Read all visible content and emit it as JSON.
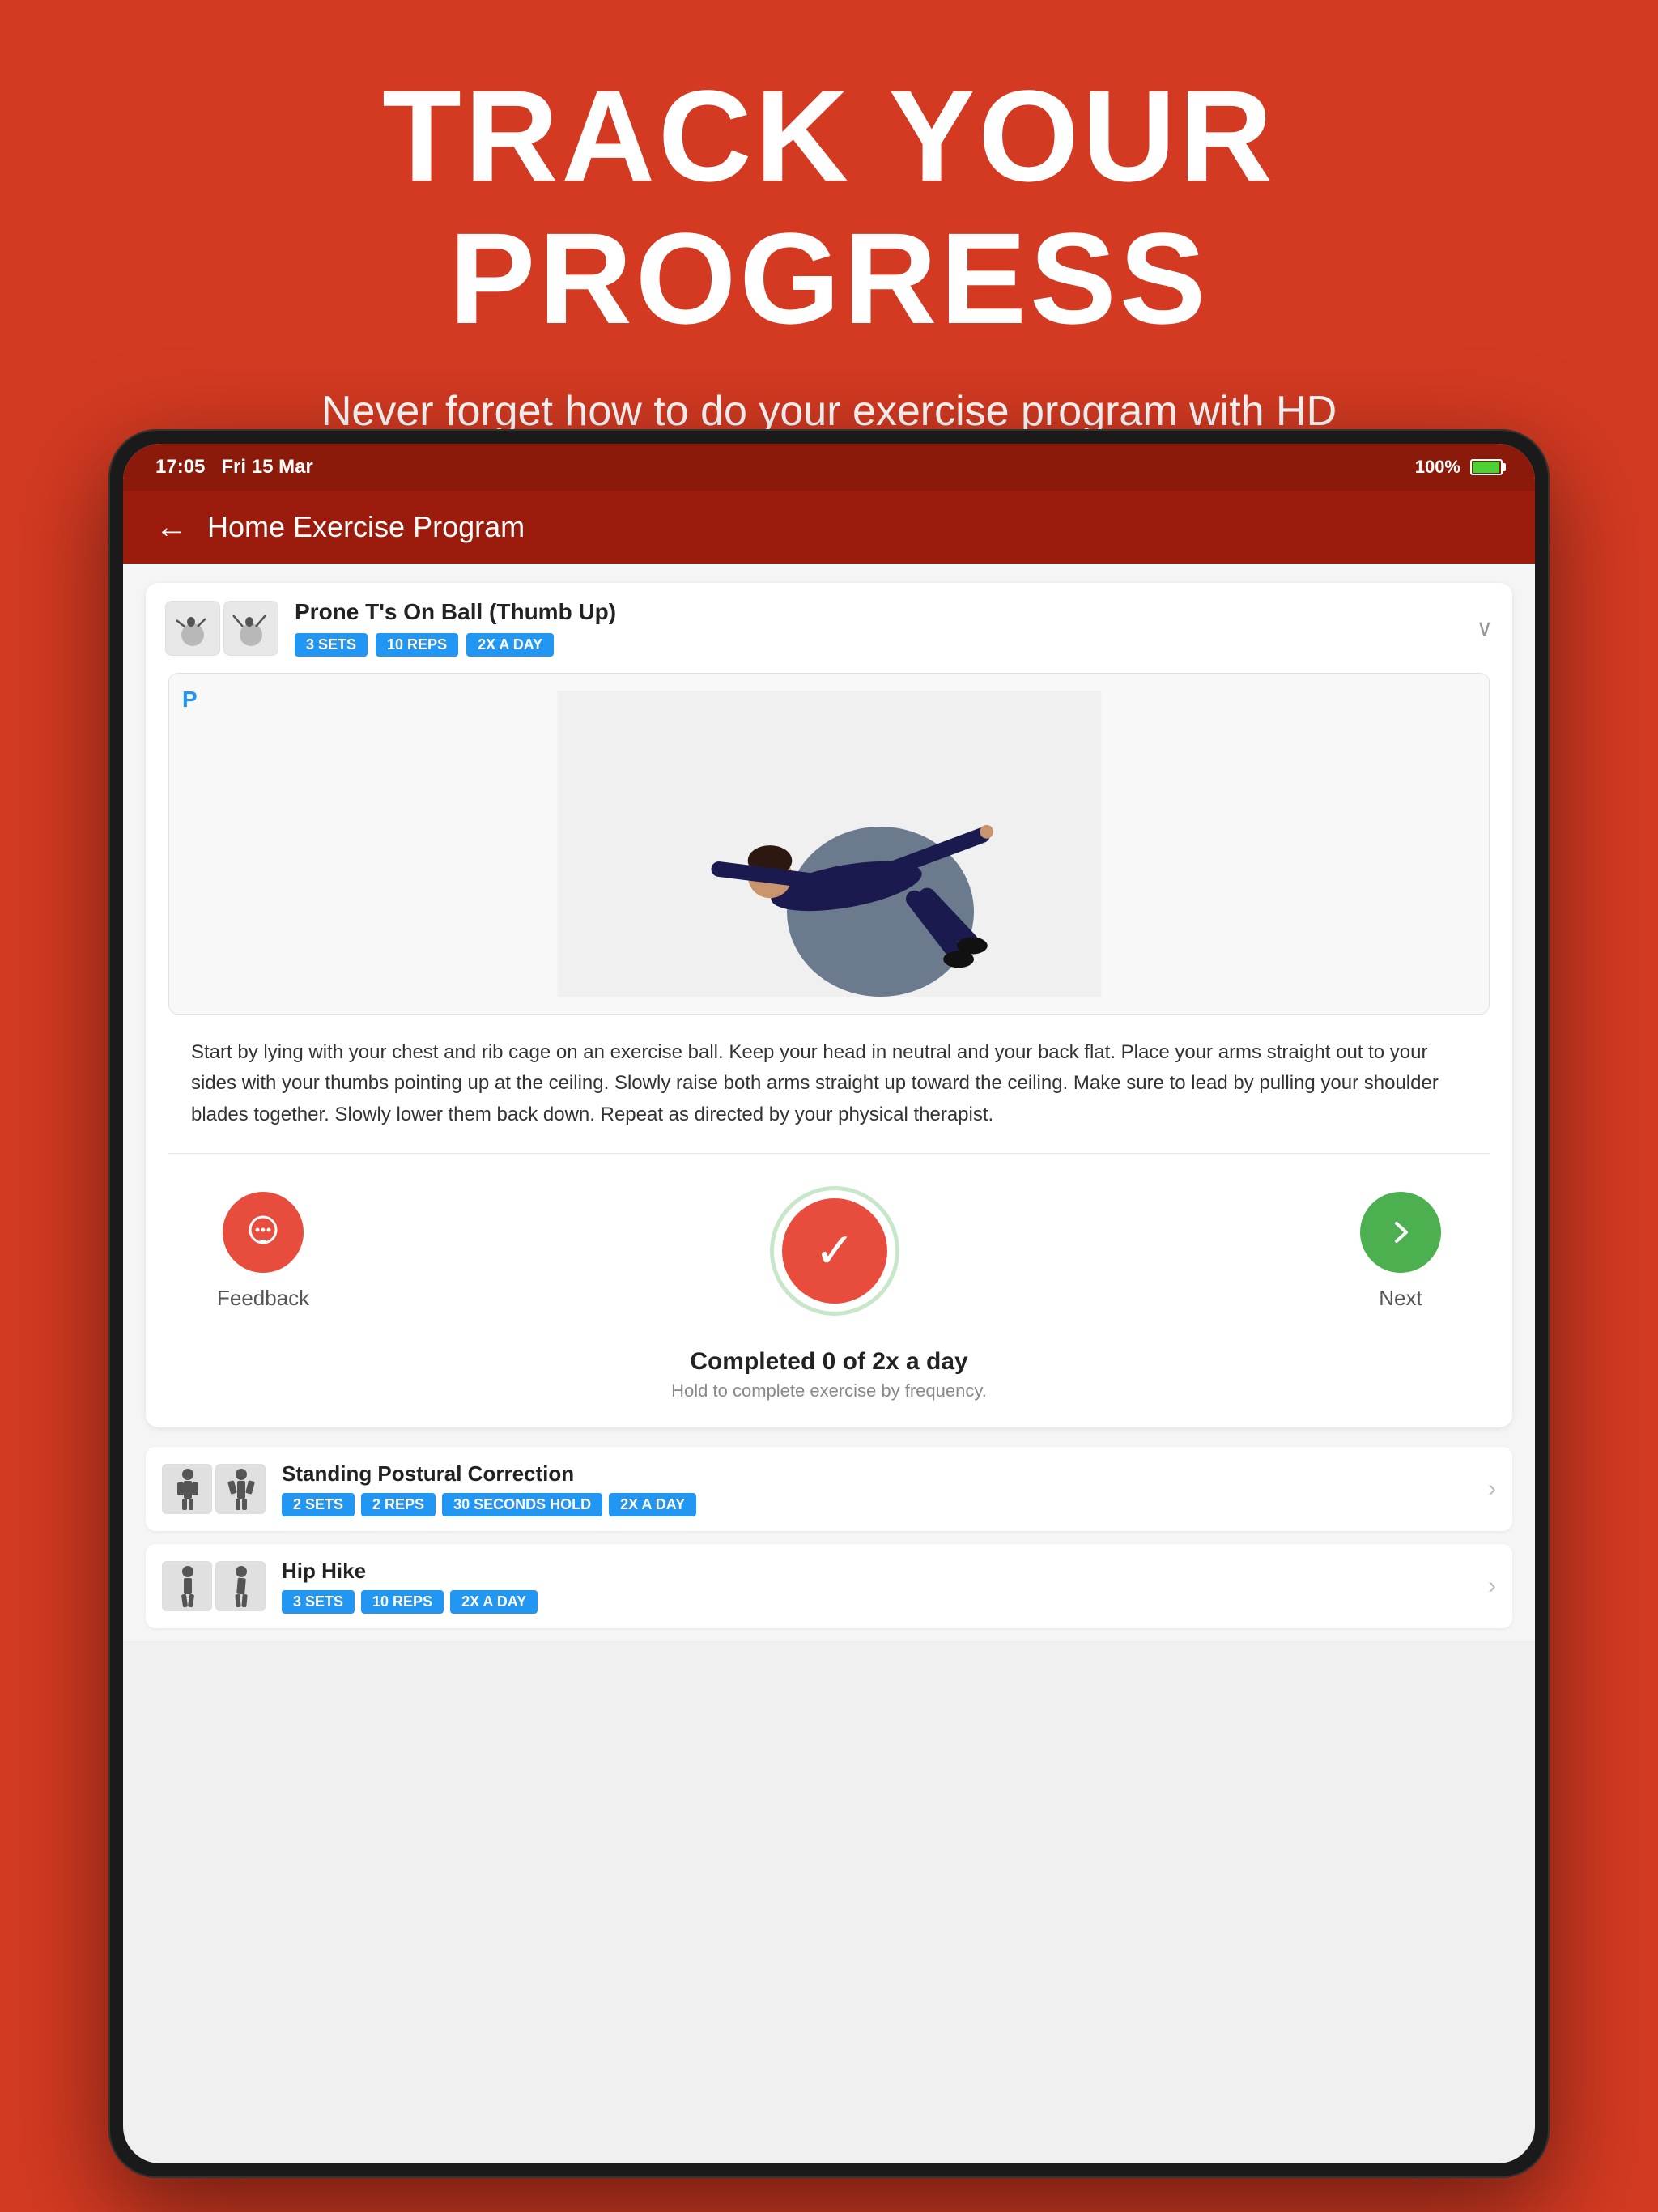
{
  "header": {
    "title": "TRACK YOUR PROGRESS",
    "subtitle": "Never forget how to do your exercise program with HD instructional videos and notes from your provider."
  },
  "status_bar": {
    "time": "17:05",
    "date": "Fri 15 Mar",
    "battery": "100%"
  },
  "app_header": {
    "title": "Home Exercise Program",
    "back_label": "←"
  },
  "exercise": {
    "name": "Prone T's On Ball (Thumb Up)",
    "tags": [
      "3 SETS",
      "10 REPS",
      "2X A DAY"
    ],
    "description": "Start by lying with your chest and rib cage on an exercise ball. Keep your head in neutral and your back flat. Place your arms straight out to your sides with your thumbs pointing up at the ceiling. Slowly raise both arms straight up toward the ceiling. Make sure to lead by pulling your shoulder blades together. Slowly lower them back down. Repeat as directed by your physical therapist.",
    "watermark": "P"
  },
  "actions": {
    "feedback_label": "Feedback",
    "next_label": "Next",
    "completed_title": "Completed 0 of 2x a day",
    "completed_subtitle": "Hold to complete exercise by frequency."
  },
  "exercise_list": [
    {
      "name": "Standing Postural Correction",
      "tags": [
        "2 SETS",
        "2 REPS",
        "30 SECONDS HOLD",
        "2X A DAY"
      ]
    },
    {
      "name": "Hip Hike",
      "tags": [
        "3 SETS",
        "10 REPS",
        "2X A DAY"
      ]
    }
  ],
  "colors": {
    "brand_red": "#d43a22",
    "dark_red": "#9b1c0c",
    "blue_tag": "#2196f3",
    "green": "#4caf50",
    "light_green_border": "#c8e6c9"
  }
}
